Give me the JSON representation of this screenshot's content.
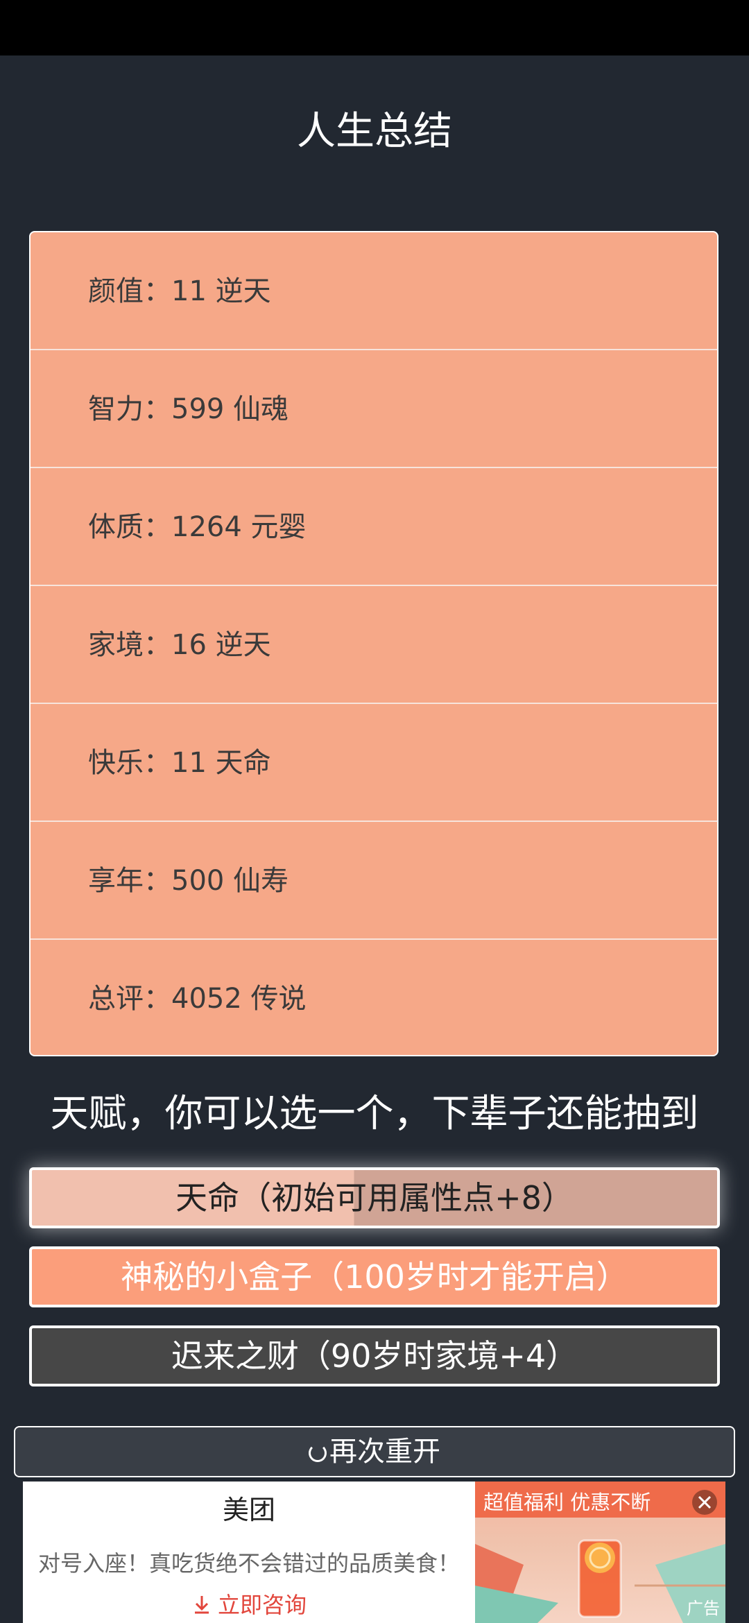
{
  "header": {
    "title": "人生总结"
  },
  "summary": {
    "rows": [
      {
        "text": "颜值：11 逆天"
      },
      {
        "text": "智力：599 仙魂"
      },
      {
        "text": "体质：1264 元婴"
      },
      {
        "text": "家境：16 逆天"
      },
      {
        "text": "快乐：11 天命"
      },
      {
        "text": "享年：500 仙寿"
      },
      {
        "text": "总评：4052 传说"
      }
    ]
  },
  "talents": {
    "heading": "天赋，你可以选一个，下辈子还能抽到",
    "options": [
      {
        "label": "天命（初始可用属性点+8）"
      },
      {
        "label": "神秘的小盒子（100岁时才能开启）"
      },
      {
        "label": "迟来之财（90岁时家境+4）"
      }
    ]
  },
  "actions": {
    "restart_label": "再次重开"
  },
  "ad": {
    "brand": "美团",
    "description": "对号入座！真吃货绝不会错过的品质美食！",
    "cta": "立即咨询",
    "promo": "超值福利 优惠不断",
    "label": "广告"
  },
  "colors": {
    "background": "#222831",
    "card": "#f6a888",
    "accent": "#fb9e7b",
    "dark_option": "#474747"
  }
}
